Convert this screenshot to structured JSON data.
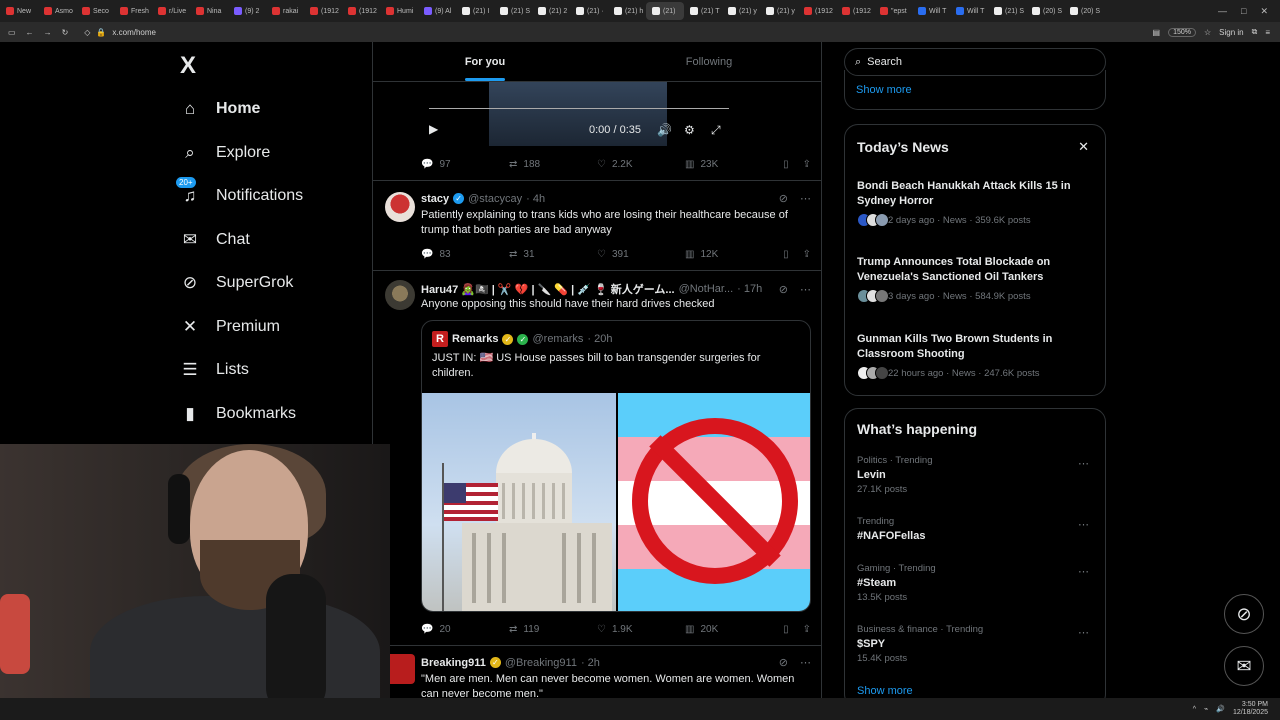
{
  "browser": {
    "tabs": [
      {
        "label": "New",
        "icon": "reddit"
      },
      {
        "label": "Asmo",
        "icon": "reddit"
      },
      {
        "label": "Seco",
        "icon": "reddit"
      },
      {
        "label": "Fresh",
        "icon": "reddit"
      },
      {
        "label": "r/Live",
        "icon": "reddit"
      },
      {
        "label": "Nina",
        "icon": "reddit"
      },
      {
        "label": "(9) 2",
        "icon": "twitch"
      },
      {
        "label": "rakai",
        "icon": "other"
      },
      {
        "label": "(1912",
        "icon": "youtube"
      },
      {
        "label": "(1912",
        "icon": "youtube"
      },
      {
        "label": "Humi",
        "icon": "reddit"
      },
      {
        "label": "(9) Al",
        "icon": "twitch"
      },
      {
        "label": "(21) I",
        "icon": "x"
      },
      {
        "label": "(21) S",
        "icon": "x"
      },
      {
        "label": "(21) 2",
        "icon": "x"
      },
      {
        "label": "(21) ·",
        "icon": "x"
      },
      {
        "label": "(21) h",
        "icon": "x"
      },
      {
        "label": "(21)",
        "icon": "x"
      },
      {
        "label": "(21) T",
        "icon": "x"
      },
      {
        "label": "(21) y",
        "icon": "x"
      },
      {
        "label": "(21) y",
        "icon": "x"
      },
      {
        "label": "(1912",
        "icon": "youtube"
      },
      {
        "label": "(1912",
        "icon": "youtube"
      },
      {
        "label": "\"epst",
        "icon": "youtube"
      },
      {
        "label": "Will T",
        "icon": "bluesky"
      },
      {
        "label": "Will T",
        "icon": "bluesky"
      },
      {
        "label": "(21) S",
        "icon": "x"
      },
      {
        "label": "(20) S",
        "icon": "x"
      },
      {
        "label": "(20) S",
        "icon": "x"
      }
    ],
    "url": "x.com/home",
    "zoom": "150%",
    "sign_in": "Sign in"
  },
  "nav": {
    "logo": "X",
    "items": [
      {
        "label": "Home",
        "icon": "home-icon"
      },
      {
        "label": "Explore",
        "icon": "search-icon"
      },
      {
        "label": "Notifications",
        "icon": "bell-icon",
        "badge": "20+"
      },
      {
        "label": "Chat",
        "icon": "mail-icon"
      },
      {
        "label": "SuperGrok",
        "icon": "grok-icon"
      },
      {
        "label": "Premium",
        "icon": "x-icon"
      },
      {
        "label": "Lists",
        "icon": "list-icon"
      },
      {
        "label": "Bookmarks",
        "icon": "bookmark-icon"
      }
    ]
  },
  "feed": {
    "tabs": [
      "For you",
      "Following"
    ],
    "video": {
      "time": "0:00 / 0:35"
    },
    "video_stats": {
      "replies": "97",
      "reposts": "188",
      "likes": "2.2K",
      "views": "23K"
    },
    "tweets": [
      {
        "name": "stacy",
        "handle": "@stacycay",
        "time": "· 4h",
        "text": "Patiently explaining to trans kids who are losing their healthcare because of trump that both parties are bad anyway",
        "replies": "83",
        "reposts": "31",
        "likes": "391",
        "views": "12K"
      },
      {
        "name": "Haru47 🧟‍♀️🏴‍☠️ | ✂️ 💔 | 🔪 💊 | 💉 🍷 新人ゲーム...",
        "handle": "@NotHar...",
        "time": "· 17h",
        "text": "Anyone opposing this should have their hard drives checked",
        "replies": "20",
        "reposts": "119",
        "likes": "1.9K",
        "views": "20K",
        "quote": {
          "name": "Remarks",
          "handle": "@remarks",
          "time": "· 20h",
          "text": "JUST IN: 🇺🇸 US House passes bill to ban transgender surgeries for children."
        }
      },
      {
        "name": "Breaking911",
        "handle": "@Breaking911",
        "time": "· 2h",
        "text": "\"Men are men. Men can never become women. Women are women. Women can never become men.\""
      }
    ]
  },
  "sidebar": {
    "search_placeholder": "Search",
    "show_more": "Show more",
    "news": {
      "title": "Today’s News",
      "items": [
        {
          "title": "Bondi Beach Hanukkah Attack Kills 15 in Sydney Horror",
          "meta": "2 days ago · News · 359.6K posts"
        },
        {
          "title": "Trump Announces Total Blockade on Venezuela's Sanctioned Oil Tankers",
          "meta": "3 days ago · News · 584.9K posts"
        },
        {
          "title": "Gunman Kills Two Brown Students in Classroom Shooting",
          "meta": "22 hours ago · News · 247.6K posts"
        }
      ]
    },
    "happening": {
      "title": "What’s happening",
      "items": [
        {
          "category": "Politics · Trending",
          "name": "Levin",
          "posts": "27.1K posts"
        },
        {
          "category": "Trending",
          "name": "#NAFOFellas",
          "posts": ""
        },
        {
          "category": "Gaming · Trending",
          "name": "#Steam",
          "posts": "13.5K posts"
        },
        {
          "category": "Business & finance · Trending",
          "name": "$SPY",
          "posts": "15.4K posts"
        }
      ],
      "show_more": "Show more"
    }
  },
  "taskbar": {
    "time": "3:50 PM",
    "date": "12/18/2025"
  },
  "colors": {
    "accent": "#1d9bf0",
    "background": "#000000",
    "border": "#2f3336",
    "muted": "#71767b"
  }
}
